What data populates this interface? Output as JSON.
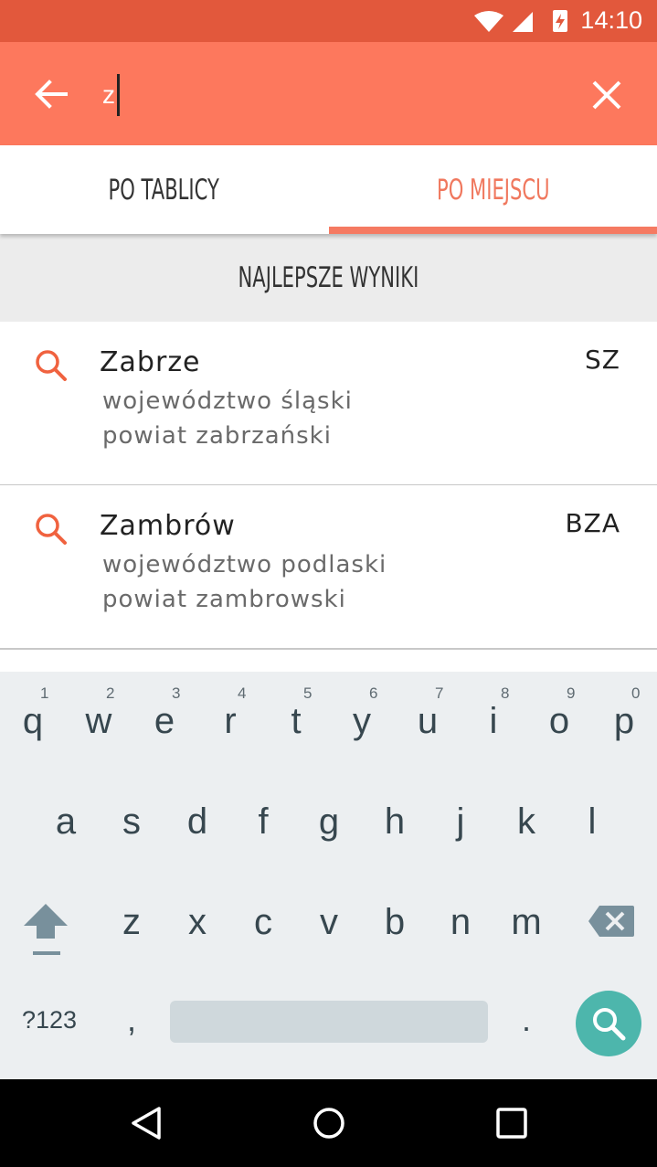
{
  "status_bar": {
    "time": "14:10"
  },
  "search": {
    "query": "z"
  },
  "tabs": [
    {
      "label": "PO TABLICY",
      "active": false
    },
    {
      "label": "PO MIEJSCU",
      "active": true
    }
  ],
  "section_header": "NAJLEPSZE WYNIKI",
  "results": [
    {
      "name": "Zabrze",
      "code": "SZ",
      "voivodeship": "województwo śląski",
      "county": "powiat zabrzański"
    },
    {
      "name": "Zambrów",
      "code": "BZA",
      "voivodeship": "województwo podlaski",
      "county": "powiat zambrowski"
    }
  ],
  "keyboard": {
    "row1": [
      {
        "ch": "q",
        "hint": "1"
      },
      {
        "ch": "w",
        "hint": "2"
      },
      {
        "ch": "e",
        "hint": "3"
      },
      {
        "ch": "r",
        "hint": "4"
      },
      {
        "ch": "t",
        "hint": "5"
      },
      {
        "ch": "y",
        "hint": "6"
      },
      {
        "ch": "u",
        "hint": "7"
      },
      {
        "ch": "i",
        "hint": "8"
      },
      {
        "ch": "o",
        "hint": "9"
      },
      {
        "ch": "p",
        "hint": "0"
      }
    ],
    "row2": [
      "a",
      "s",
      "d",
      "f",
      "g",
      "h",
      "j",
      "k",
      "l"
    ],
    "row3": [
      "z",
      "x",
      "c",
      "v",
      "b",
      "n",
      "m"
    ],
    "symbols_label": "?123",
    "comma": ",",
    "period": "."
  },
  "colors": {
    "status_bar": "#e2583c",
    "app_bar": "#fd785d",
    "accent": "#f57a62",
    "search_fab": "#4db6ac"
  }
}
